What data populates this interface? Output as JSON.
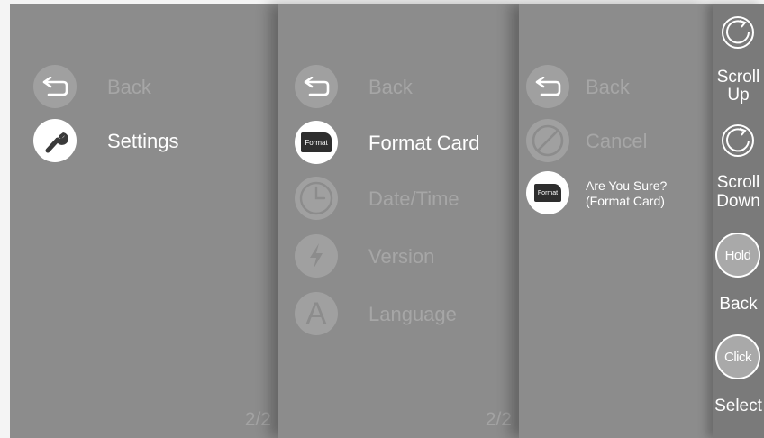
{
  "panel1": {
    "items": [
      {
        "label": "Back",
        "icon": "back-arrow-icon"
      },
      {
        "label": "Settings",
        "icon": "wrench-icon"
      }
    ],
    "page": "2/2"
  },
  "panel2": {
    "items": [
      {
        "label": "Back",
        "icon": "back-arrow-icon"
      },
      {
        "label": "Format Card",
        "icon": "format-card-icon",
        "icon_text": "Format"
      },
      {
        "label": "Date/Time",
        "icon": "clock-icon"
      },
      {
        "label": "Version",
        "icon": "lightning-icon"
      },
      {
        "label": "Language",
        "icon": "letter-a-icon",
        "icon_text": "A"
      }
    ],
    "page": "2/2"
  },
  "panel3": {
    "items": [
      {
        "label": "Back",
        "icon": "back-arrow-icon"
      },
      {
        "label": "Cancel",
        "icon": "cancel-icon"
      },
      {
        "label_line1": "Are You Sure?",
        "label_line2": "(Format Card)",
        "icon": "format-card-icon",
        "icon_text": "Format"
      }
    ]
  },
  "controls": {
    "scroll_up": {
      "line1": "Scroll",
      "line2": "Up"
    },
    "scroll_down": {
      "line1": "Scroll",
      "line2": "Down"
    },
    "back": {
      "button_text": "Hold",
      "label": "Back"
    },
    "select": {
      "button_text": "Click",
      "label": "Select"
    }
  },
  "colors": {
    "panel_bg": "#8c8c8c",
    "sidebar_bg": "#7a7a7a",
    "dim_text": "#a6a6a6",
    "highlight": "#ffffff"
  }
}
